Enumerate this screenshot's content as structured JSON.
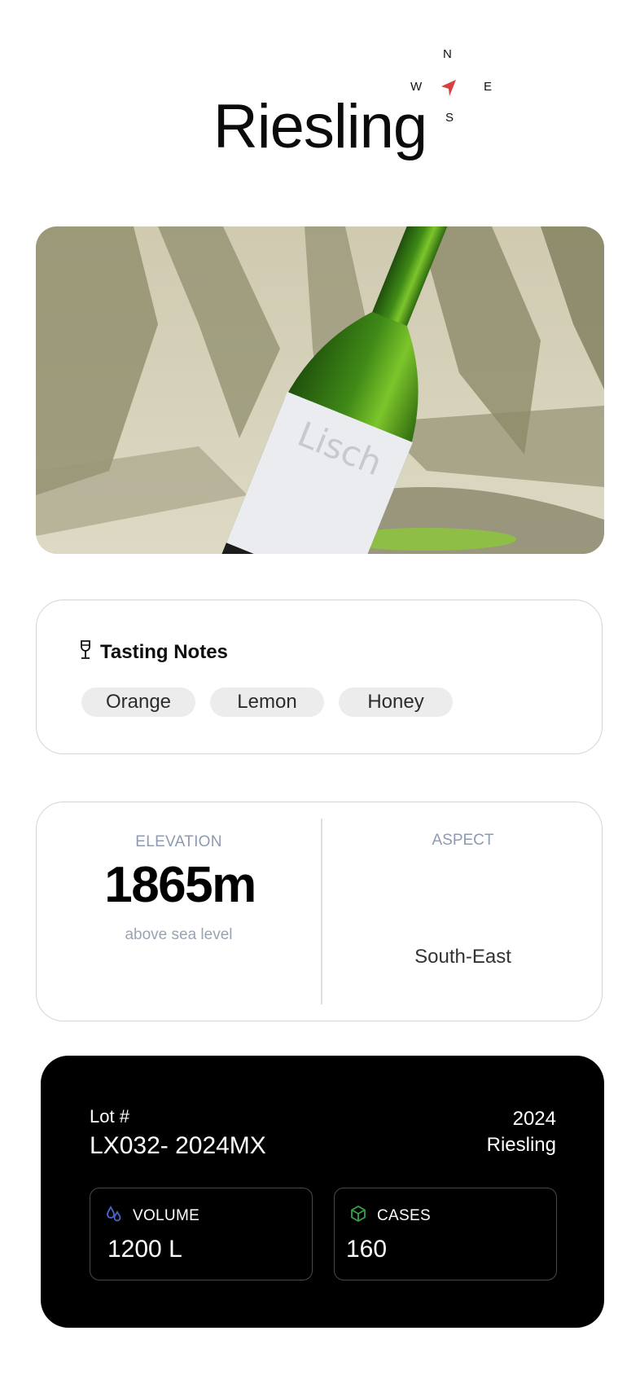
{
  "page": {
    "title": "Riesling"
  },
  "hero_image": {
    "alt": ""
  },
  "tasting_notes": {
    "title": "Tasting Notes",
    "icon": "wine-glass-icon",
    "notes": [
      "Orange",
      "Lemon",
      "Honey"
    ]
  },
  "elevation": {
    "label": "ELEVATION",
    "value": "1865m",
    "subtitle": "above sea level"
  },
  "aspect": {
    "label": "ASPECT",
    "compass": {
      "n": "N",
      "w": "W",
      "e": "E",
      "s": "S"
    },
    "value": "South-East",
    "needle_color": "#d94040"
  },
  "lot": {
    "label": "Lot #",
    "code": "LX032- 2024MX",
    "year": "2024",
    "variety": "Riesling",
    "volume": {
      "label": "VOLUME",
      "value": "1200 L",
      "icon": "droplets-icon",
      "icon_color": "#4b66c9"
    },
    "cases": {
      "label": "CASES",
      "value": "160",
      "icon": "box-icon",
      "icon_color": "#3aa04a"
    }
  }
}
